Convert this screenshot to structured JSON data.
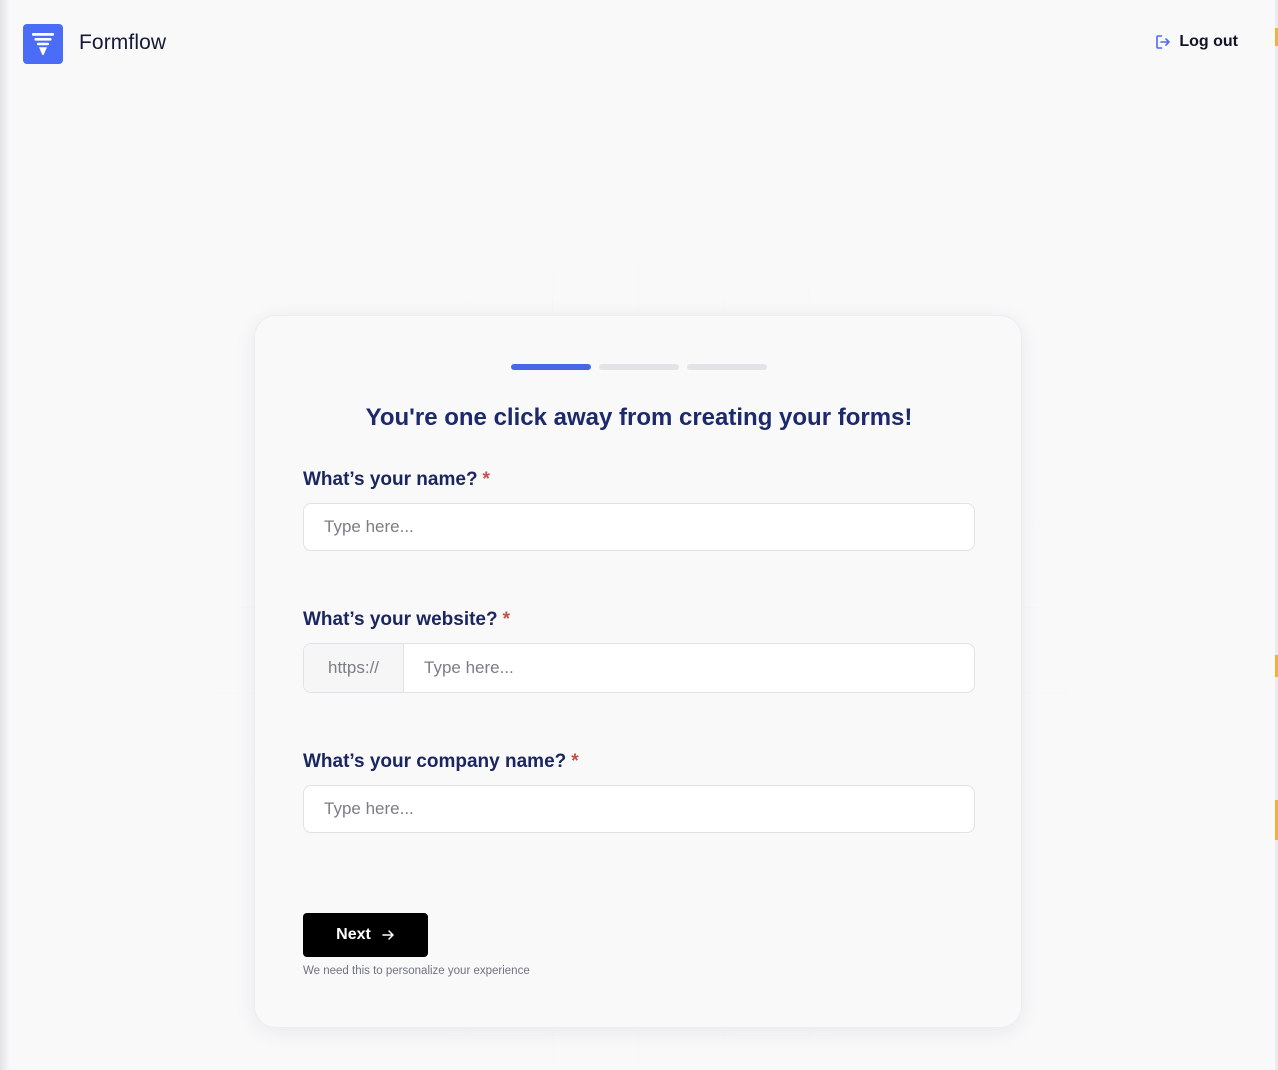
{
  "header": {
    "brand": "Formflow",
    "logout_label": "Log out"
  },
  "onboarding": {
    "progress": {
      "current_step": 1,
      "total_steps": 3
    },
    "title": "You're one click away from creating your forms!",
    "fields": {
      "name": {
        "label": "What’s your name?",
        "required_mark": "*",
        "placeholder": "Type here..."
      },
      "website": {
        "label": "What’s your website?",
        "required_mark": "*",
        "prefix": "https://",
        "placeholder": "Type here..."
      },
      "company": {
        "label": "What’s your company name?",
        "required_mark": "*",
        "placeholder": "Type here..."
      }
    },
    "next_label": "Next",
    "hint": "We need this to personalize your experience"
  },
  "colors": {
    "brand": "#4a6cf7",
    "progress_active": "#4767e6",
    "progress_inactive": "#e4e4e8",
    "heading": "#1c2a6b",
    "required": "#c0524a",
    "button": "#000000"
  },
  "icons": {
    "logo": "formflow-logo-icon",
    "logout": "logout-icon",
    "next": "arrow-right-icon"
  }
}
